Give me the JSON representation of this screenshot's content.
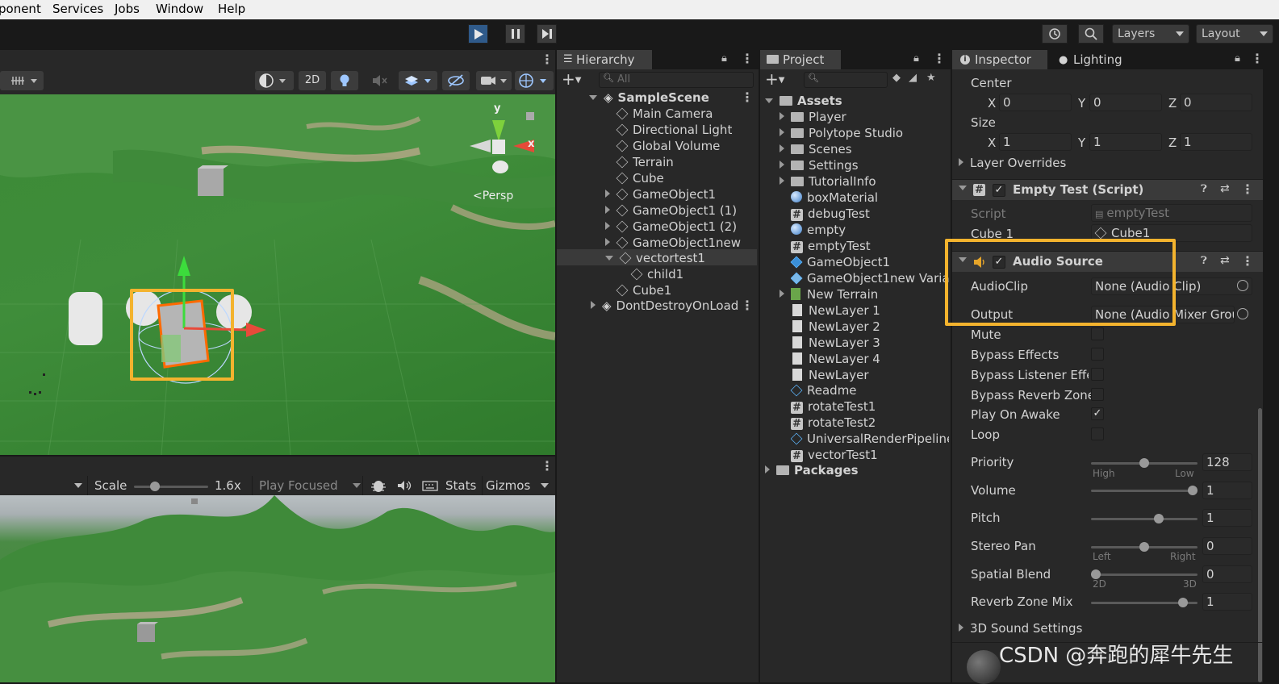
{
  "menu": [
    "ponent",
    "Services",
    "Jobs",
    "Window",
    "Help"
  ],
  "toolbar": {
    "layers": "Layers",
    "layout": "Layout"
  },
  "scene": {
    "btn2d": "2D",
    "persp": "Persp",
    "axis_y": "y",
    "axis_x": "x"
  },
  "game": {
    "scale_label": "Scale",
    "scale_value": "1.6x",
    "play_focused": "Play Focused",
    "stats": "Stats",
    "gizmos": "Gizmos"
  },
  "hierarchy": {
    "title": "Hierarchy",
    "search": "All",
    "scene": "SampleScene",
    "items": [
      "Main Camera",
      "Directional Light",
      "Global Volume",
      "Terrain",
      "Cube",
      "GameObject1",
      "GameObject1 (1)",
      "GameObject1 (2)",
      "GameObject1new",
      "vectortest1",
      "child1",
      "Cube1"
    ],
    "dont_destroy": "DontDestroyOnLoad"
  },
  "project": {
    "title": "Project",
    "root": "Assets",
    "items": [
      "Player",
      "Polytope Studio",
      "Scenes",
      "Settings",
      "TutorialInfo",
      "boxMaterial",
      "debugTest",
      "empty",
      "emptyTest",
      "GameObject1",
      "GameObject1new Variant",
      "New Terrain",
      "NewLayer 1",
      "NewLayer 2",
      "NewLayer 3",
      "NewLayer 4",
      "NewLayer",
      "Readme",
      "rotateTest1",
      "rotateTest2",
      "UniversalRenderPipeline",
      "vectorTest1"
    ],
    "packages": "Packages"
  },
  "inspector": {
    "tab_inspector": "Inspector",
    "tab_lighting": "Lighting",
    "center": "Center",
    "size": "Size",
    "x": "X",
    "y": "Y",
    "z": "Z",
    "center_vals": [
      "0",
      "0",
      "0"
    ],
    "size_vals": [
      "1",
      "1",
      "1"
    ],
    "layer_overrides": "Layer Overrides",
    "empty_test": {
      "title": "Empty Test (Script)",
      "script_label": "Script",
      "script_value": "emptyTest",
      "cube_label": "Cube 1",
      "cube_value": "Cube1"
    },
    "audio": {
      "title": "Audio Source",
      "audioclip_label": "AudioClip",
      "audioclip_value": "None (Audio Clip)",
      "output_label": "Output",
      "output_value": "None (Audio Mixer Group)",
      "mute": "Mute",
      "bypass_effects": "Bypass Effects",
      "bypass_listener": "Bypass Listener Effe",
      "bypass_reverb": "Bypass Reverb Zone",
      "play_on_awake": "Play On Awake",
      "loop": "Loop",
      "priority_label": "Priority",
      "priority_value": "128",
      "priority_high": "High",
      "priority_low": "Low",
      "volume_label": "Volume",
      "volume_value": "1",
      "pitch_label": "Pitch",
      "pitch_value": "1",
      "stereo_label": "Stereo Pan",
      "stereo_value": "0",
      "stereo_left": "Left",
      "stereo_right": "Right",
      "spatial_label": "Spatial Blend",
      "spatial_value": "0",
      "spatial_2d": "2D",
      "spatial_3d": "3D",
      "reverb_label": "Reverb Zone Mix",
      "reverb_value": "1",
      "sound3d": "3D Sound Settings",
      "levels": {
        "priority": 0.5,
        "volume": 1.0,
        "pitch": 0.65,
        "stereo": 0.5,
        "spatial": 0.0,
        "reverb": 0.9
      }
    }
  },
  "watermark": "CSDN @奔跑的犀牛先生"
}
